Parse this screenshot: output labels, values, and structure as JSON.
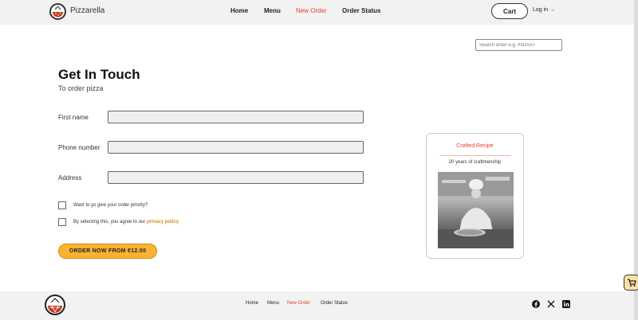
{
  "brand": "Pizzarella",
  "nav": {
    "home": "Home",
    "menu": "Menu",
    "new_order": "New Order",
    "order_status": "Order Status"
  },
  "header_actions": {
    "cart": "Cart",
    "login": "Log in →"
  },
  "search": {
    "placeholder": "Search order e.g. #IIDSAT"
  },
  "form": {
    "title": "Get In Touch",
    "subtitle": "To order pizza",
    "first_name_label": "First name",
    "phone_label": "Phone number",
    "address_label": "Address",
    "priority_label": "Want to yo give your order priority?",
    "agree_prefix": "By selecting this, you agree to our ",
    "privacy_link": "privacy policy",
    "order_button": "ORDER NOW FROM €12.00"
  },
  "card": {
    "title": "Crafted Recipe",
    "subtitle": "20 years of craftmenship"
  },
  "footer": {
    "home": "Home",
    "menu": "Menu",
    "new_order": "New Order",
    "order_status": "Order Status"
  },
  "colors": {
    "accent": "#e0442b",
    "button": "#f9b233",
    "link": "#d98a1f"
  },
  "icons": [
    "pizza-logo-icon",
    "facebook-icon",
    "x-icon",
    "linkedin-icon",
    "cart-icon"
  ]
}
